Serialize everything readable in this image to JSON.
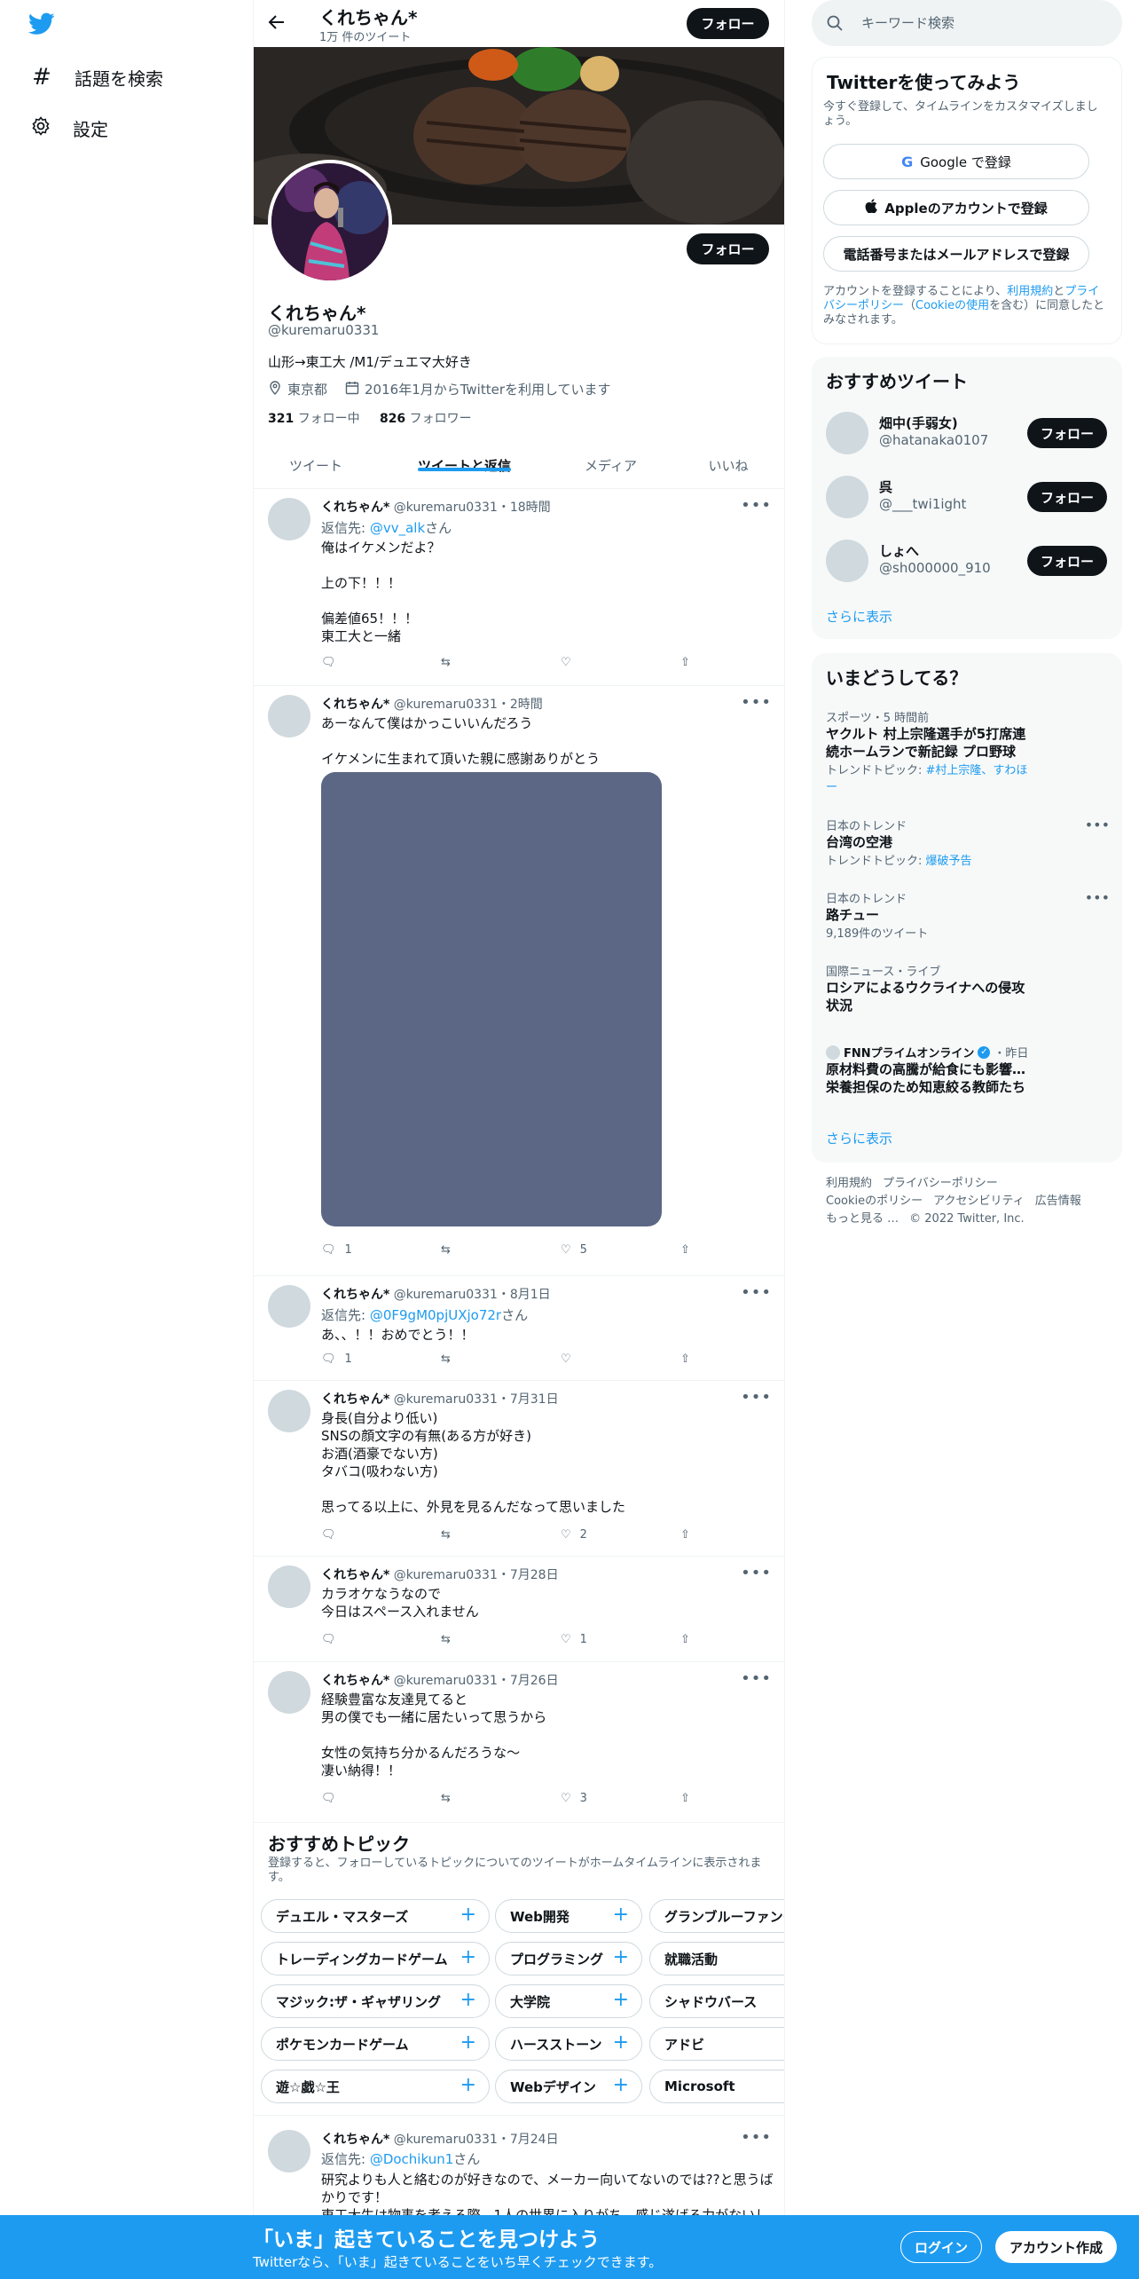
{
  "nav": {
    "explore_label": "話題を検索",
    "settings_label": "設定"
  },
  "header": {
    "name": "くれちゃん*",
    "tweet_count": "1万 件のツイート",
    "follow_label": "フォロー"
  },
  "profile": {
    "follow_label": "フォロー",
    "name": "くれちゃん*",
    "handle": "@kuremaru0331",
    "bio": "山形→東工大 /M1/デュエマ大好き",
    "location": "東京都",
    "joined": "2016年1月からTwitterを利用しています",
    "following_count": "321",
    "following_label": "フォロー中",
    "followers_count": "826",
    "followers_label": "フォロワー"
  },
  "tabs": [
    "ツイート",
    "ツイートと返信",
    "メディア",
    "いいね"
  ],
  "tweets": [
    {
      "name": "くれちゃん*",
      "meta": "@kuremaru0331・18時間",
      "reply_prefix": "返信先: ",
      "reply_to": "@vv_alk",
      "reply_suffix": "さん",
      "text": "俺はイケメンだよ？\n\n上の下！！！\n\n偏差値65！！！\n東工大と一緒",
      "replies": "",
      "retweets": "",
      "likes": ""
    },
    {
      "name": "くれちゃん*",
      "meta": "@kuremaru0331・2時間",
      "text": "あーなんて僕はかっこいいんだろう\n\nイケメンに生まれて頂いた親に感謝ありがとう",
      "replies": "1",
      "retweets": "",
      "likes": "5"
    },
    {
      "name": "くれちゃん*",
      "meta": "@kuremaru0331・8月1日",
      "reply_prefix": "返信先: ",
      "reply_to": "@0F9gM0pjUXjo72r",
      "reply_suffix": "さん",
      "text": "あ、、！！おめでとう！！",
      "replies": "1",
      "retweets": "",
      "likes": ""
    },
    {
      "name": "くれちゃん*",
      "meta": "@kuremaru0331・7月31日",
      "text": "身長(自分より低い)\nSNSの顔文字の有無(ある方が好き)\nお酒(酒豪でない方)\nタバコ(吸わない方)\n\n思ってる以上に、外見を見るんだなって思いました",
      "replies": "",
      "retweets": "",
      "likes": "2"
    },
    {
      "name": "くれちゃん*",
      "meta": "@kuremaru0331・7月28日",
      "text": "カラオケなうなので\n今日はスペース入れません",
      "replies": "",
      "retweets": "",
      "likes": "1"
    },
    {
      "name": "くれちゃん*",
      "meta": "@kuremaru0331・7月26日",
      "text": "経験豊富な友達見てると\n男の僕でも一緒に居たいって思うから\n\n女性の気持ち分かるんだろうな〜\n凄い納得！！",
      "replies": "",
      "retweets": "",
      "likes": "3"
    },
    {
      "name": "くれちゃん*",
      "meta": "@kuremaru0331・7月24日",
      "reply_prefix": "返信先: ",
      "reply_to": "@Dochikun1",
      "reply_suffix": "さん",
      "text": "研究よりも人と絡むのが好きなので、メーカー向いてないのでは??と思うばかりです！\n東工大生は物事を考える際、1人の世界に入りがち、感じ遂げる力がないし"
    }
  ],
  "topics": {
    "title": "おすすめトピック",
    "subtitle": "登録すると、フォローしているトピックについてのツイートがホームタイムラインに表示されます。",
    "rows": [
      [
        "デュエル・マスターズ",
        "Web開発",
        "グランブルーファンタジー"
      ],
      [
        "トレーディングカードゲーム",
        "プログラミング",
        "就職活動"
      ],
      [
        "マジック:ザ・ギャザリング",
        "大学院",
        "シャドウバース"
      ],
      [
        "ポケモンカードゲーム",
        "ハースストーン",
        "アドビ"
      ],
      [
        "遊☆戯☆王",
        "Webデザイン",
        "Microsoft"
      ]
    ]
  },
  "search": {
    "placeholder": "キーワード検索"
  },
  "signup": {
    "title": "Twitterを使ってみよう",
    "subtitle": "今すぐ登録して、タイムラインをカスタマイズしましょう。",
    "google": "Google で登録",
    "apple": "Appleのアカウントで登録",
    "phone": "電話番号またはメールアドレスで登録",
    "legal_1": "アカウントを登録することにより、",
    "legal_terms": "利用規約",
    "legal_and": "と",
    "legal_privacy": "プライバシーポリシー",
    "legal_paren_open": "（",
    "legal_cookie": "Cookieの使用",
    "legal_2": "を含む）に同意したとみなされます。"
  },
  "who_to_follow": {
    "title": "おすすめツイート",
    "users": [
      {
        "name": "畑中(手弱女)",
        "handle": "@hatanaka0107",
        "follow_label": "フォロー"
      },
      {
        "name": "呉",
        "handle": "@___twi1ight",
        "follow_label": "フォロー"
      },
      {
        "name": "しょへ",
        "handle": "@sh000000_910",
        "follow_label": "フォロー"
      }
    ],
    "show_more": "さらに表示"
  },
  "trends": {
    "title": "いまどうしてる？",
    "items": [
      {
        "category": "スポーツ・5 時間前",
        "title": "ヤクルト 村上宗隆選手が5打席連続ホームランで新記録 プロ野球",
        "sub_prefix": "トレンドトピック: ",
        "sub_link": "#村上宗隆、すわほー"
      },
      {
        "category": "日本のトレンド",
        "title": "台湾の空港",
        "sub_prefix": "トレンドトピック: ",
        "sub_link": "爆破予告"
      },
      {
        "category": "日本のトレンド",
        "title": "路チュー",
        "sub_prefix": "9,189件のツイート",
        "sub_link": ""
      },
      {
        "category": "国際ニュース・ライブ",
        "title": "ロシアによるウクライナへの侵攻状況",
        "sub_prefix": "",
        "sub_link": ""
      },
      {
        "category": "FNNプライムオンライン",
        "category_suffix": "・昨日",
        "title": "原材料費の高騰が給食にも影響…栄養担保のため知恵絞る教師たち",
        "sub_prefix": "",
        "sub_link": ""
      }
    ],
    "show_more": "さらに表示"
  },
  "footer": {
    "terms": "利用規約",
    "privacy": "プライバシーポリシー",
    "cookie": "Cookieのポリシー",
    "accessibility": "アクセシビリティ",
    "ads": "広告情報",
    "more": "もっと見る …",
    "copyright": "© 2022 Twitter, Inc."
  },
  "bottom_bar": {
    "title": "「いま」起きていることを見つけよう",
    "subtitle": "Twitterなら、「いま」起きていることをいち早くチェックできます。",
    "login": "ログイン",
    "signup": "アカウント作成"
  },
  "colors": {
    "accent": "#1d9bf0",
    "text": "#0f1419",
    "muted": "#536471",
    "bottom_bar": "#1d9bf0"
  }
}
